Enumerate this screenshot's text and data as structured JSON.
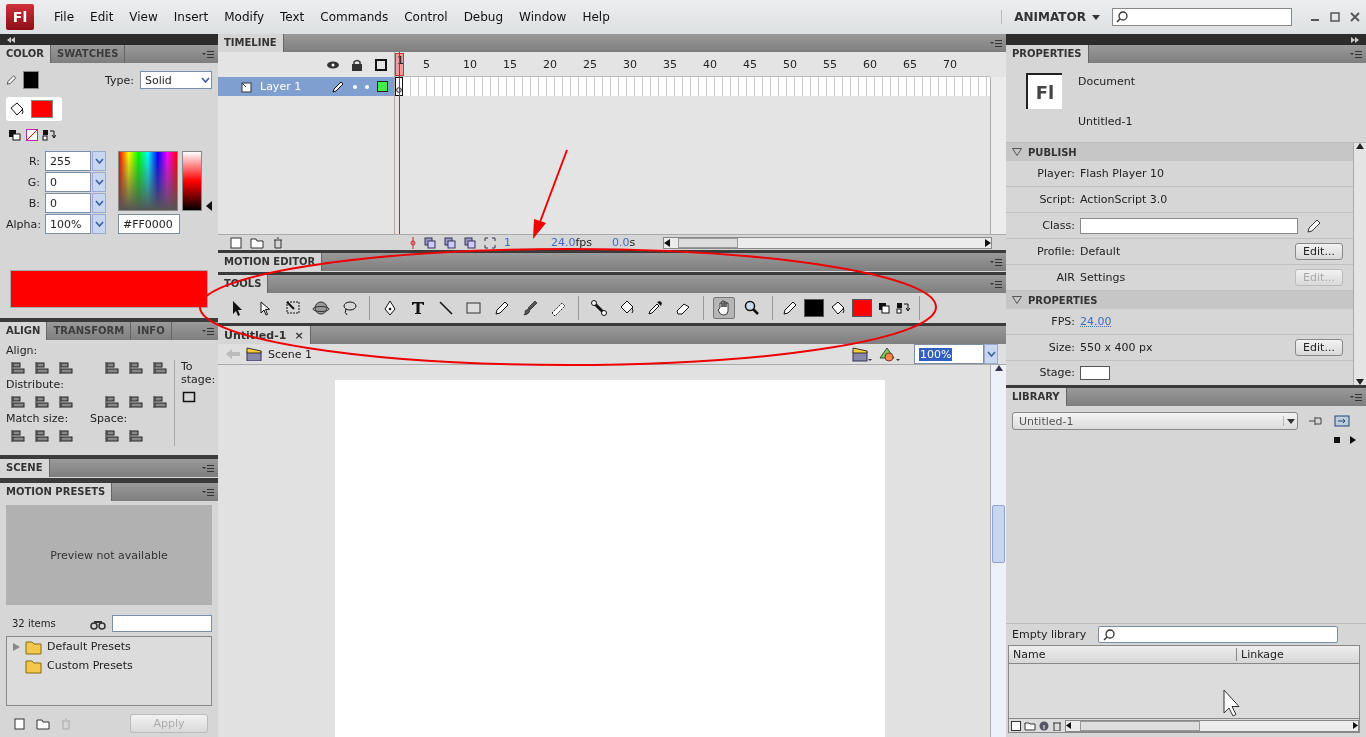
{
  "menu_bar": {
    "logo": "Fl",
    "items": [
      "File",
      "Edit",
      "View",
      "Insert",
      "Modify",
      "Text",
      "Commands",
      "Control",
      "Debug",
      "Window",
      "Help"
    ],
    "workspace": "ANIMATOR"
  },
  "color_panel": {
    "tabs": [
      {
        "label": "COLOR",
        "selected": true
      },
      {
        "label": "SWATCHES",
        "selected": false
      }
    ],
    "type_label": "Type:",
    "type_value": "Solid",
    "swatches": [
      {
        "kind": "stroke",
        "color": "#000000"
      },
      {
        "kind": "fill",
        "color": "#ff0000"
      }
    ],
    "channels": [
      {
        "label": "R:",
        "value": "255"
      },
      {
        "label": "G:",
        "value": "0"
      },
      {
        "label": "B:",
        "value": "0"
      },
      {
        "label": "Alpha:",
        "value": "100%"
      }
    ],
    "hex": "#FF0000"
  },
  "align_panel": {
    "tabs": [
      {
        "label": "ALIGN",
        "selected": true
      },
      {
        "label": "TRANSFORM",
        "selected": false
      },
      {
        "label": "INFO",
        "selected": false
      }
    ],
    "align_label": "Align:",
    "distribute_label": "Distribute:",
    "match_label": "Match size:",
    "space_label": "Space:",
    "stage_label": "To stage:"
  },
  "scene_panel": {
    "title": "SCENE"
  },
  "motion_presets": {
    "title": "MOTION PRESETS",
    "preview": "Preview not available",
    "count": "32 items",
    "tree": [
      {
        "label": "Default Presets",
        "expandable": true,
        "expanded": false
      },
      {
        "label": "Custom Presets",
        "expandable": false
      }
    ],
    "apply": "Apply",
    "apply_disabled": true
  },
  "timeline": {
    "title": "TIMELINE",
    "frame_numbers": [
      "1",
      "5",
      "10",
      "15",
      "20",
      "25",
      "30",
      "35",
      "40",
      "45",
      "50",
      "55",
      "60",
      "65",
      "70"
    ],
    "layers": [
      {
        "name": "Layer 1",
        "selected": true,
        "color": "#44ee44"
      }
    ],
    "status": {
      "frame": "1",
      "fps": "24.0",
      "fps_unit": "fps",
      "time": "0.0",
      "time_unit": "s"
    }
  },
  "motion_editor": {
    "title": "MOTION EDITOR"
  },
  "tools": {
    "title": "TOOLS",
    "groups": [
      [
        {
          "selected": false
        },
        {
          "selected": false
        },
        {
          "selected": false
        },
        {
          "selected": false
        },
        {
          "selected": false
        }
      ],
      [
        {
          "selected": false
        },
        {
          "selected": false
        },
        {
          "selected": false
        },
        {
          "selected": false
        },
        {
          "selected": false
        },
        {
          "selected": false
        },
        {
          "selected": false
        }
      ],
      [
        {
          "selected": false
        },
        {
          "selected": false
        },
        {
          "selected": false
        },
        {
          "selected": false
        }
      ],
      [
        {
          "selected": true
        },
        {
          "selected": false
        }
      ]
    ],
    "color_chips": [
      {
        "kind": "stroke",
        "color": "#000000"
      },
      {
        "kind": "fill",
        "color": "#ff0000"
      }
    ]
  },
  "document": {
    "tab": "Untitled-1",
    "tab_close": "×",
    "scene": "Scene 1",
    "zoom": "100%"
  },
  "properties": {
    "title": "PROPERTIES",
    "doc_logo": "Fl",
    "doc_type": "Document",
    "doc_name": "Untitled-1",
    "sections": [
      {
        "title": "PUBLISH",
        "expanded": true,
        "rows": [
          {
            "kind": "text",
            "label": "Player:",
            "value": "Flash Player 10"
          },
          {
            "kind": "text",
            "label": "Script:",
            "value": "ActionScript 3.0"
          },
          {
            "kind": "field",
            "label": "Class:"
          },
          {
            "kind": "button",
            "label": "Profile:",
            "value": "Default",
            "button": "Edit...",
            "disabled": false
          },
          {
            "kind": "button",
            "label": "AIR",
            "value": "Settings",
            "button": "Edit...",
            "disabled": true
          }
        ]
      },
      {
        "title": "PROPERTIES",
        "expanded": true,
        "rows": [
          {
            "kind": "link",
            "label": "FPS:",
            "value": "24.00"
          },
          {
            "kind": "button",
            "label": "Size:",
            "value": "550 x 400 px",
            "button": "Edit...",
            "disabled": false
          },
          {
            "kind": "swatch",
            "label": "Stage:"
          }
        ]
      }
    ]
  },
  "library": {
    "title": "LIBRARY",
    "document": "Untitled-1",
    "status": "Empty library",
    "columns": [
      "Name",
      "Linkage"
    ]
  }
}
